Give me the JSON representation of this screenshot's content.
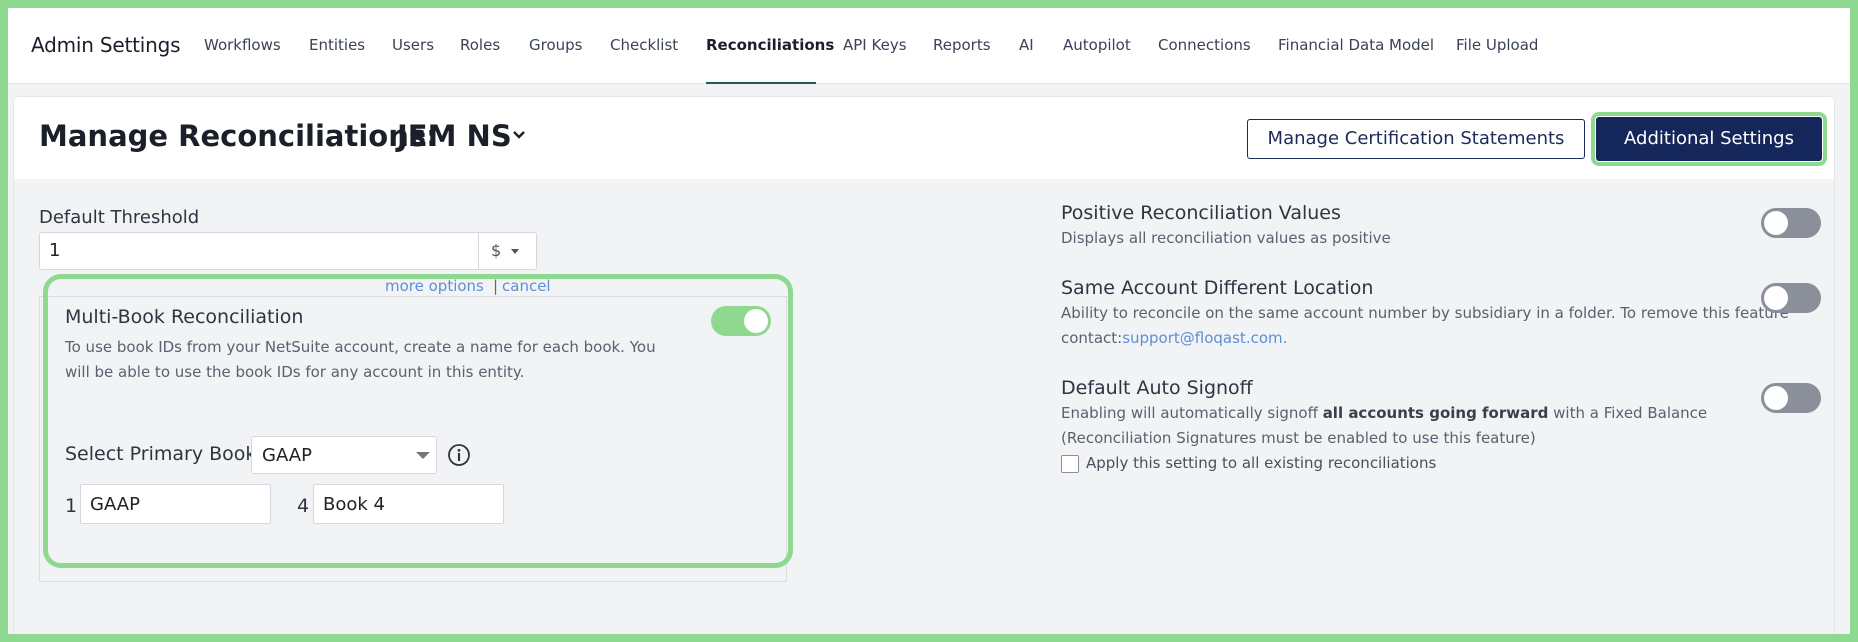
{
  "topnav": {
    "app_title": "Admin Settings",
    "tabs": [
      {
        "label": "Workflows"
      },
      {
        "label": "Entities"
      },
      {
        "label": "Users"
      },
      {
        "label": "Roles"
      },
      {
        "label": "Groups"
      },
      {
        "label": "Checklist"
      },
      {
        "label": "Reconciliations",
        "active": true
      },
      {
        "label": "API Keys"
      },
      {
        "label": "Reports"
      },
      {
        "label": "AI"
      },
      {
        "label": "Autopilot"
      },
      {
        "label": "Connections"
      },
      {
        "label": "Financial Data Model"
      },
      {
        "label": "File Upload"
      }
    ]
  },
  "header": {
    "title": "Manage Reconciliations:",
    "entity": "JEM NS",
    "manage_cert_button": "Manage Certification Statements",
    "additional_settings_button": "Additional Settings"
  },
  "threshold": {
    "label": "Default Threshold",
    "value": "1",
    "currency": "$",
    "more_options": "more options",
    "separator": "|",
    "cancel": "cancel"
  },
  "multibook": {
    "title": "Multi-Book Reconciliation",
    "description": "To use book IDs from your NetSuite account, create a name for each book. You will be able to use the book IDs for any account in this entity.",
    "enabled": true,
    "primary_label": "Select Primary Book",
    "primary_value": "GAAP",
    "books": [
      {
        "num": "1",
        "name": "GAAP"
      },
      {
        "num": "4",
        "name": "Book 4"
      }
    ]
  },
  "options": {
    "positive": {
      "title": "Positive Reconciliation Values",
      "desc": "Displays all reconciliation values as positive",
      "enabled": false
    },
    "same_account": {
      "title": "Same Account Different Location",
      "desc1": "Ability to reconcile on the same account number by subsidiary in a folder. To remove this feature",
      "desc2_prefix": "contact:",
      "desc2_link": "support@floqast.com.",
      "enabled": false
    },
    "auto_signoff": {
      "title": "Default Auto Signoff",
      "desc1_prefix": "Enabling will automatically signoff ",
      "desc1_bold": "all accounts going forward",
      "desc1_suffix": " with a Fixed Balance",
      "desc2": "(Reconciliation Signatures must be enabled to use this feature)",
      "checkbox_label": "Apply this setting to all existing reconciliations",
      "checkbox_checked": false,
      "enabled": false
    }
  },
  "colors": {
    "accent_green": "#8fd88f",
    "primary_navy": "#14265a",
    "link_blue": "#5d8fd6",
    "toggle_off": "#8a8f9a"
  }
}
